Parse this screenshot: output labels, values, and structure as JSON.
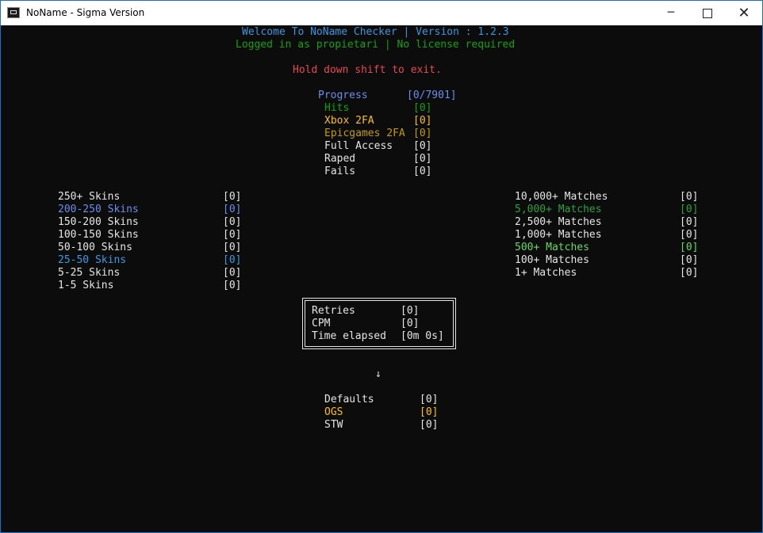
{
  "window": {
    "title": "NoName - Sigma Version",
    "min_glyph": "─",
    "close_glyph": "✕"
  },
  "header": {
    "welcome": "Welcome To NoName Checker | Version : 1.2.3",
    "login": "Logged in as propietari | No license required",
    "exit_hint": "Hold down shift to exit."
  },
  "progress": {
    "label": "Progress",
    "value": "[0/7901]",
    "rows": [
      {
        "label": "Hits",
        "value": "[0]"
      },
      {
        "label": "Xbox 2FA",
        "value": "[0]"
      },
      {
        "label": "Epicgames 2FA",
        "value": "[0]"
      },
      {
        "label": "Full Access",
        "value": "[0]"
      },
      {
        "label": "Raped",
        "value": "[0]"
      },
      {
        "label": "Fails",
        "value": "[0]"
      }
    ]
  },
  "skins": [
    {
      "label": "250+ Skins",
      "value": "[0]"
    },
    {
      "label": "200-250 Skins",
      "value": "[0]"
    },
    {
      "label": "150-200 Skins",
      "value": "[0]"
    },
    {
      "label": "100-150 Skins",
      "value": "[0]"
    },
    {
      "label": "50-100 Skins",
      "value": "[0]"
    },
    {
      "label": "25-50 Skins",
      "value": "[0]"
    },
    {
      "label": "5-25 Skins",
      "value": "[0]"
    },
    {
      "label": "1-5 Skins",
      "value": "[0]"
    }
  ],
  "matches": [
    {
      "label": "10,000+ Matches",
      "value": "[0]"
    },
    {
      "label": "5,000+ Matches",
      "value": "[0]"
    },
    {
      "label": "2,500+ Matches",
      "value": "[0]"
    },
    {
      "label": "1,000+ Matches",
      "value": "[0]"
    },
    {
      "label": "500+ Matches",
      "value": "[0]"
    },
    {
      "label": "100+ Matches",
      "value": "[0]"
    },
    {
      "label": "1+ Matches",
      "value": "[0]"
    }
  ],
  "stats": [
    {
      "label": "Retries",
      "value": "[0]"
    },
    {
      "label": "CPM",
      "value": "[0]"
    },
    {
      "label": "Time elapsed",
      "value": "[0m 0s]"
    }
  ],
  "arrow": "↓",
  "extras": [
    {
      "label": "Defaults",
      "value": "[0]"
    },
    {
      "label": "OGS",
      "value": "[0]"
    },
    {
      "label": "STW",
      "value": "[0]"
    }
  ]
}
